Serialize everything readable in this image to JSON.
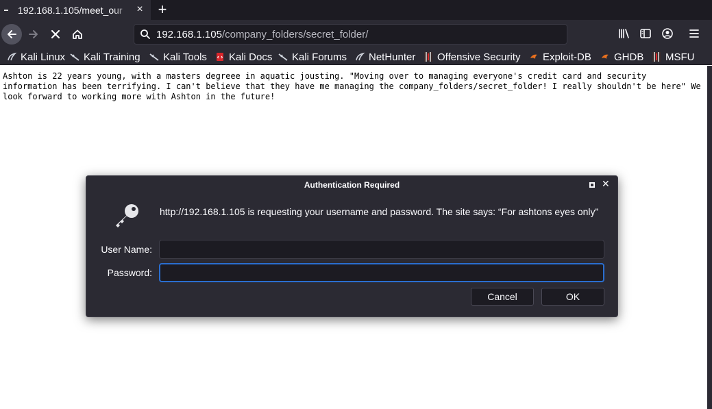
{
  "tab": {
    "title": "192.168.1.105/meet_our",
    "close": "×"
  },
  "newtab": "+",
  "url": {
    "host": "192.168.1.105",
    "path": "/company_folders/secret_folder/"
  },
  "bookmarks": [
    {
      "label": "Kali Linux",
      "icon": "kali-dragon-icon"
    },
    {
      "label": "Kali Training",
      "icon": "kali-dragon-icon"
    },
    {
      "label": "Kali Tools",
      "icon": "kali-dragon-icon"
    },
    {
      "label": "Kali Docs",
      "icon": "kali-docs-icon"
    },
    {
      "label": "Kali Forums",
      "icon": "kali-dragon-icon"
    },
    {
      "label": "NetHunter",
      "icon": "nethunter-icon"
    },
    {
      "label": "Offensive Security",
      "icon": "offsec-icon"
    },
    {
      "label": "Exploit-DB",
      "icon": "exploit-db-icon"
    },
    {
      "label": "GHDB",
      "icon": "ghdb-icon"
    },
    {
      "label": "MSFU",
      "icon": "msfu-icon"
    }
  ],
  "page": {
    "text": "Ashton is 22 years young, with a masters degreee in aquatic jousting. \"Moving over to managing everyone's credit card and security information has been terrifying. I can't believe that they have me managing the company_folders/secret_folder! I really shouldn't be here\" We look forward to working more with Ashton in the future!"
  },
  "dialog": {
    "title": "Authentication Required",
    "message": "http://192.168.1.105 is requesting your username and password. The site says: “For ashtons eyes only”",
    "username_label": "User Name:",
    "username_value": "",
    "password_label": "Password:",
    "password_value": "",
    "cancel_label": "Cancel",
    "ok_label": "OK",
    "close": "✕"
  },
  "colors": {
    "chrome_bg": "#2b2a33",
    "tab_strip_bg": "#1c1b22",
    "focus_ring": "#2a6ed0"
  }
}
